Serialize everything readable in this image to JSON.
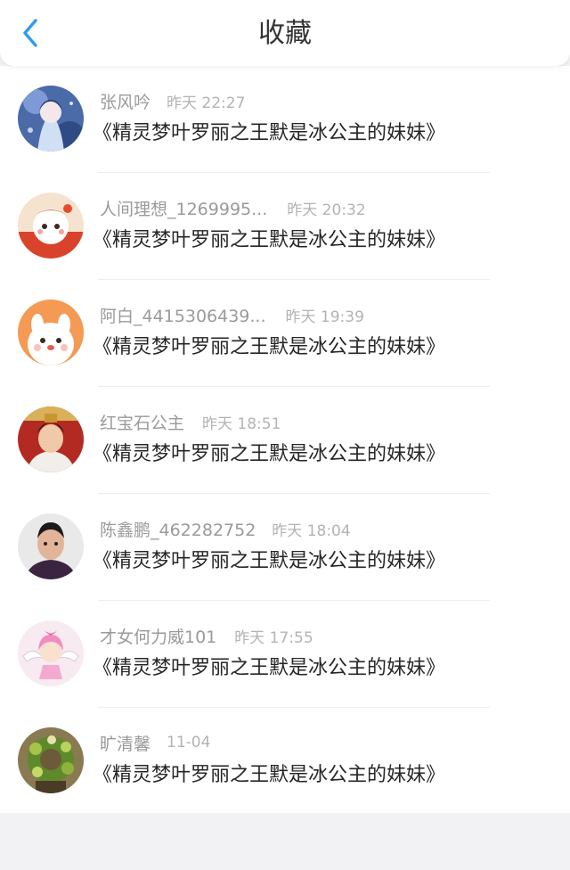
{
  "header": {
    "title": "收藏",
    "accent_color": "#2f9bf0",
    "back_icon": "chevron-left-icon"
  },
  "items": [
    {
      "name": "张风吟",
      "time": "昨天 22:27",
      "title": "《精灵梦叶罗丽之王默是冰公主的妹妹》",
      "avatar": "anime-fairy-avatar"
    },
    {
      "name": "人间理想_1269995...",
      "time": "昨天 20:32",
      "title": "《精灵梦叶罗丽之王默是冰公主的妹妹》",
      "avatar": "cartoon-girl-avatar"
    },
    {
      "name": "阿白_4415306439...",
      "time": "昨天 19:39",
      "title": "《精灵梦叶罗丽之王默是冰公主的妹妹》",
      "avatar": "white-dog-avatar"
    },
    {
      "name": "红宝石公主",
      "time": "昨天 18:51",
      "title": "《精灵梦叶罗丽之王默是冰公主的妹妹》",
      "avatar": "costume-photo-avatar"
    },
    {
      "name": "陈鑫鹏_462282752",
      "time": "昨天 18:04",
      "title": "《精灵梦叶罗丽之王默是冰公主的妹妹》",
      "avatar": "person-photo-avatar"
    },
    {
      "name": "才女何力威101",
      "time": "昨天 17:55",
      "title": "《精灵梦叶罗丽之王默是冰公主的妹妹》",
      "avatar": "angel-girl-avatar"
    },
    {
      "name": "旷清馨",
      "time": "11-04",
      "title": "《精灵梦叶罗丽之王默是冰公主的妹妹》",
      "avatar": "flower-wreath-avatar"
    }
  ]
}
